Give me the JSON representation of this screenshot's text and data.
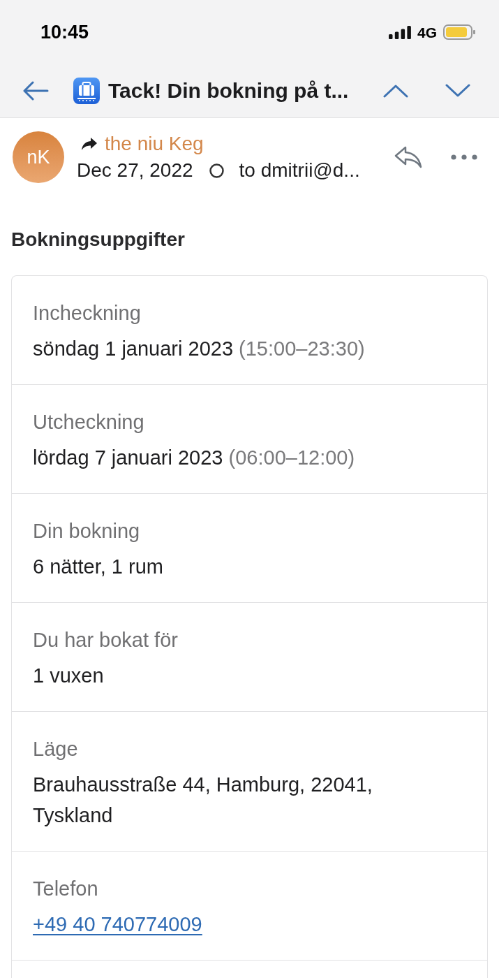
{
  "status_bar": {
    "time": "10:45",
    "network": "4G"
  },
  "header": {
    "subject": "Tack! Din bokning på t..."
  },
  "message": {
    "avatar": "nK",
    "sender": "the niu Keg",
    "forwarded": true,
    "date": "Dec 27, 2022",
    "recipient": "to dmitrii@d..."
  },
  "section_title": "Bokningsuppgifter",
  "details": [
    {
      "kind": "text",
      "label": "Incheckning",
      "value": "söndag 1 januari 2023",
      "note": "(15:00–23:30)"
    },
    {
      "kind": "text",
      "label": "Utcheckning",
      "value": "lördag 7 januari 2023",
      "note": "(06:00–12:00)"
    },
    {
      "kind": "text",
      "label": "Din bokning",
      "value": "6 nätter, 1 rum"
    },
    {
      "kind": "text",
      "label": "Du har bokat för",
      "value": "1 vuxen"
    },
    {
      "kind": "text",
      "label": "Läge",
      "value": "Brauhausstraße 44, Hamburg, 22041, Tyskland"
    },
    {
      "kind": "link",
      "label": "Telefon",
      "value": "+49 40 740774009"
    }
  ]
}
